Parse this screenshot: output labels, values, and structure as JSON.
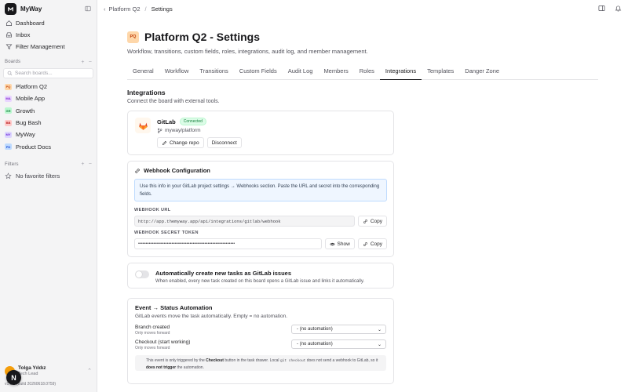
{
  "app": {
    "name": "MyWay"
  },
  "sidebar": {
    "nav": [
      {
        "label": "Dashboard",
        "icon": "home-icon"
      },
      {
        "label": "Inbox",
        "icon": "inbox-icon"
      },
      {
        "label": "Filter Management",
        "icon": "filter-icon"
      }
    ],
    "boards_label": "Boards",
    "search_placeholder": "Search boards...",
    "boards": [
      {
        "badge": "PQ",
        "label": "Platform Q2",
        "color": "#fed7aa",
        "text_color": "#c2410c"
      },
      {
        "badge": "MA",
        "label": "Mobile App",
        "color": "#e9d5ff",
        "text_color": "#7e22ce"
      },
      {
        "badge": "GR",
        "label": "Growth",
        "color": "#bbf7d0",
        "text_color": "#15803d"
      },
      {
        "badge": "BB",
        "label": "Bug Bash",
        "color": "#fecaca",
        "text_color": "#b91c1c"
      },
      {
        "badge": "MY",
        "label": "MyWay",
        "color": "#ddd6fe",
        "text_color": "#6d28d9"
      },
      {
        "badge": "PD",
        "label": "Product Docs",
        "color": "#bfdbfe",
        "text_color": "#1d4ed8"
      }
    ],
    "filters_label": "Filters",
    "no_favorites": "No favorite filters",
    "user": {
      "name": "Tolga Yıldız",
      "role": "Tech Lead"
    },
    "version": "v1.0.0 (build 20260618.0759)",
    "fab_letter": "N"
  },
  "breadcrumb": {
    "parent": "Platform Q2",
    "separator": "/",
    "current": "Settings"
  },
  "page": {
    "badge": "PQ",
    "title": "Platform Q2 - Settings",
    "subtitle": "Workflow, transitions, custom fields, roles, integrations, audit log, and member management."
  },
  "tabs": [
    "General",
    "Workflow",
    "Transitions",
    "Custom Fields",
    "Audit Log",
    "Members",
    "Roles",
    "Integrations",
    "Templates",
    "Danger Zone"
  ],
  "active_tab": "Integrations",
  "integrations": {
    "title": "Integrations",
    "subtitle": "Connect the board with external tools.",
    "gitlab": {
      "name": "GitLab",
      "status": "Connected",
      "repo": "myway/platform",
      "change_repo": "Change repo",
      "disconnect": "Disconnect"
    },
    "webhook": {
      "title": "Webhook Configuration",
      "info": "Use this info in your GitLab project settings → Webhooks section. Paste the URL and secret into the corresponding fields.",
      "url_label": "WEBHOOK URL",
      "url_value": "http://app.themyway.app/api/integrations/gitlab/webhook",
      "copy": "Copy",
      "secret_label": "WEBHOOK SECRET TOKEN",
      "secret_value": "••••••••••••••••••••••••••••••••••••••••••••••••••••••••••••••••",
      "show": "Show"
    },
    "auto_create": {
      "title": "Automatically create new tasks as GitLab issues",
      "desc": "When enabled, every new task created on this board opens a GitLab issue and links it automatically.",
      "enabled": false
    },
    "event_automation": {
      "title": "Event → Status Automation",
      "subtitle": "GitLab events move the task automatically. Empty = no automation.",
      "rows": [
        {
          "name": "Branch created",
          "hint": "Only moves forward",
          "value": "- (no automation)"
        },
        {
          "name": "Checkout (start working)",
          "hint": "Only moves forward",
          "value": "- (no automation)"
        }
      ],
      "note_pre": "This event is only triggered by the ",
      "note_b1": "Checkout",
      "note_mid": " button in the task drawer. Local ",
      "note_code": "git checkout",
      "note_mid2": " does not send a webhook to GitLab, so it ",
      "note_b2": "does not trigger",
      "note_post": " the automation."
    }
  }
}
